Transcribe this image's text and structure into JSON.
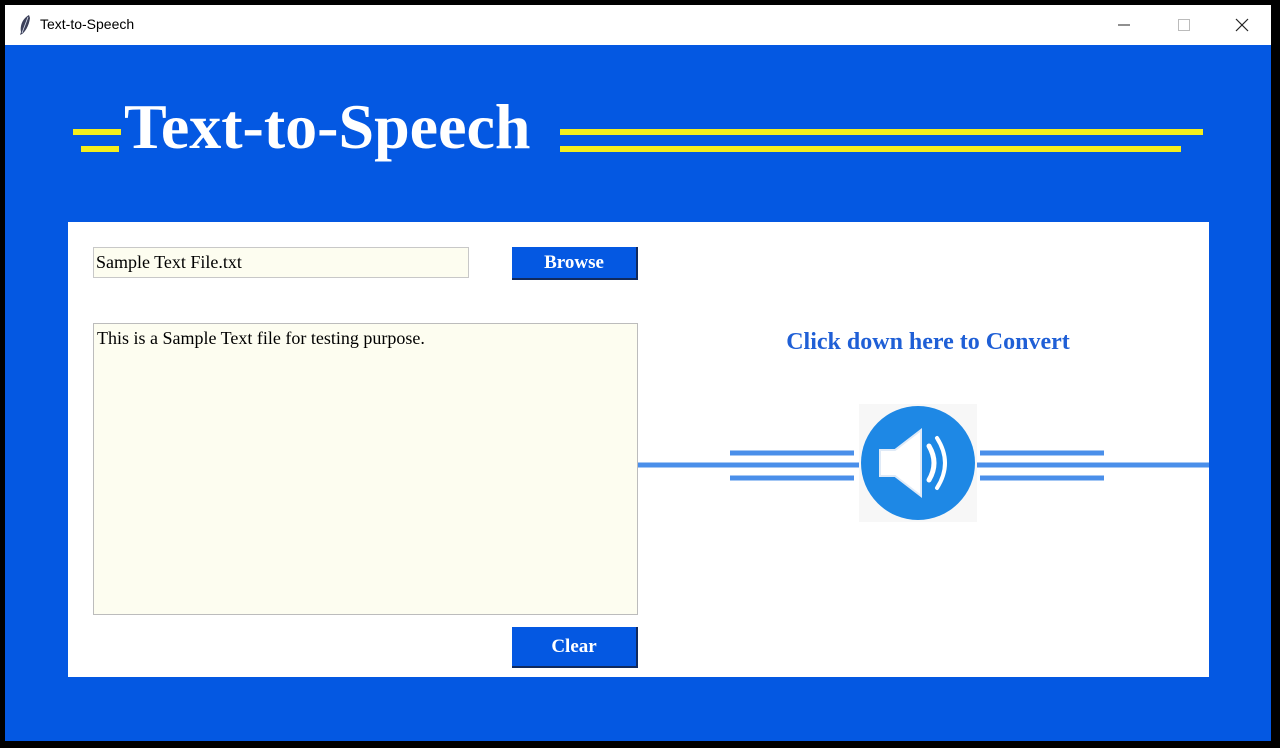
{
  "window": {
    "title": "Text-to-Speech",
    "controls": [
      "minimize",
      "maximize",
      "close"
    ]
  },
  "header": {
    "heading": "Text-to-Speech"
  },
  "file": {
    "path_value": "Sample Text File.txt",
    "browse_label": "Browse"
  },
  "editor": {
    "content": "This is a Sample Text file for testing purpose."
  },
  "convert": {
    "label": "Click down here to Convert",
    "icon": "speaker-icon"
  },
  "clear_label": "Clear",
  "colors": {
    "background": "#0458e2",
    "accent_yellow": "#f4ee1c",
    "speaker_blue": "#1e88e5",
    "panel": "#ffffff",
    "input_bg": "#fdfdf0"
  }
}
